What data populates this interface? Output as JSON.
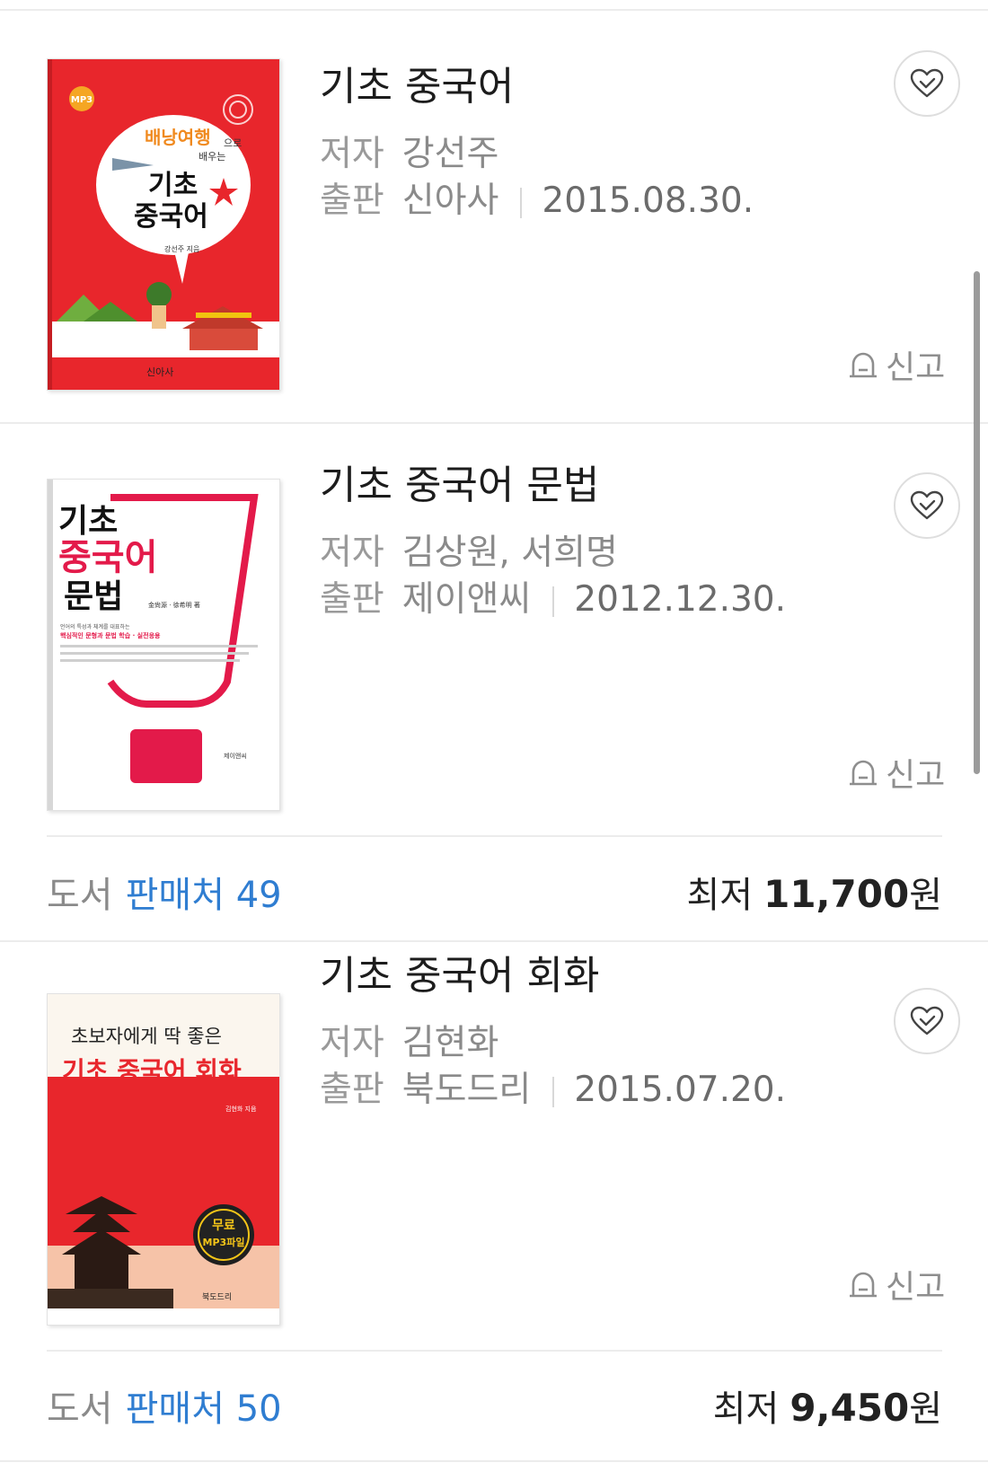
{
  "items": [
    {
      "title": "기초 중국어",
      "author_label": "저자",
      "author": "강선주",
      "publisher_label": "출판",
      "publisher": "신아사",
      "date": "2015.08.30.",
      "report_label": "신고",
      "cover": {
        "mp3": "MP3",
        "headline": "배낭여행",
        "suffix": "으로",
        "sub": "배우는",
        "title_line1": "기초",
        "title_line2": "중국어",
        "author_line": "강선주 지음",
        "publisher": "신아사"
      }
    },
    {
      "title": "기초 중국어 문법",
      "author_label": "저자",
      "author": "김상원, 서희명",
      "publisher_label": "출판",
      "publisher": "제이앤씨",
      "date": "2012.12.30.",
      "report_label": "신고",
      "store_type": "도서",
      "store_label": "판매처",
      "store_count": "49",
      "price_label": "최저",
      "price": "11,700",
      "price_unit": "원",
      "cover": {
        "line1": "기초",
        "line2": "중국어",
        "line3": "문법",
        "authors_cn": "金尙源 · 徐希明 著",
        "caption1": "언어의 특성과 체계를 대표하는",
        "caption2": "핵심적인 문형과 문법 학습 · 실전응용",
        "publisher": "제이앤씨"
      }
    },
    {
      "title": "기초 중국어 회화",
      "author_label": "저자",
      "author": "김현화",
      "publisher_label": "출판",
      "publisher": "북도드리",
      "date": "2015.07.20.",
      "report_label": "신고",
      "store_type": "도서",
      "store_label": "판매처",
      "store_count": "50",
      "price_label": "최저",
      "price": "9,450",
      "price_unit": "원",
      "cover": {
        "top_line": "초보자에게 딱 좋은",
        "title": "기초 중국어 회화",
        "author_line": "김현화 지음",
        "badge1": "무료",
        "badge2": "MP3파일",
        "publisher": "북도드리"
      }
    }
  ],
  "colors": {
    "accent_blue": "#2f7dd1",
    "cover_red": "#e8262c",
    "divider": "#ececec"
  }
}
